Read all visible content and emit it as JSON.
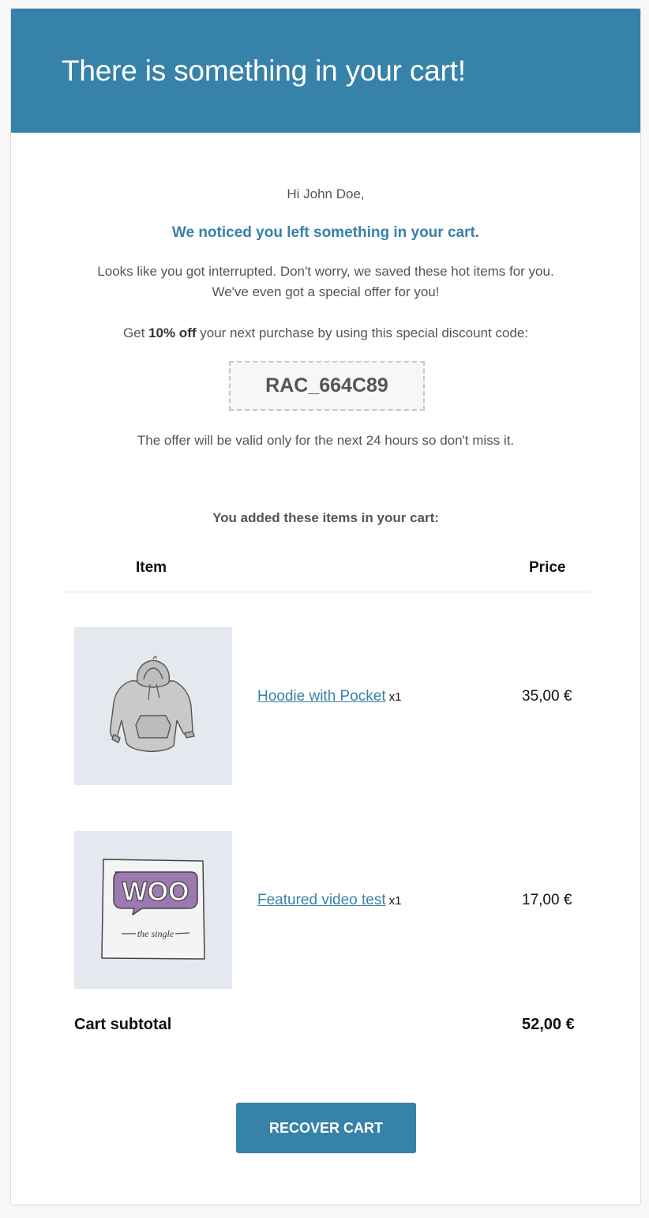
{
  "header": {
    "title": "There is something in your cart!"
  },
  "body": {
    "greeting": "Hi John Doe,",
    "notice": "We noticed you left something in your cart.",
    "intro_line1": "Looks like you got interrupted. Don't worry, we saved these hot items for you.",
    "intro_line2": "We've even got a special offer for you!",
    "offer_prefix": "Get ",
    "offer_bold": "10% off",
    "offer_suffix": " your next purchase by using this special discount code:",
    "coupon_code": "RAC_664C89",
    "validity": "The offer will be valid only for the next 24 hours so don't miss it."
  },
  "cart": {
    "title": "You added these items in your cart:",
    "columns": {
      "item": "Item",
      "price": "Price"
    },
    "items": [
      {
        "name": "Hoodie with Pocket",
        "qty": "x1",
        "price": "35,00 €",
        "image": "hoodie-image"
      },
      {
        "name": "Featured video test",
        "qty": "x1",
        "price": "17,00 €",
        "image": "woo-single-image",
        "image_text_1": "WOO",
        "image_text_2": "the single"
      }
    ],
    "subtotal_label": "Cart subtotal",
    "subtotal_value": "52,00 €"
  },
  "button": {
    "label": "RECOVER CART"
  },
  "colors": {
    "brand": "#3782a8",
    "background": "#f7f7f7",
    "thumb_bg": "#e3e9ee"
  }
}
